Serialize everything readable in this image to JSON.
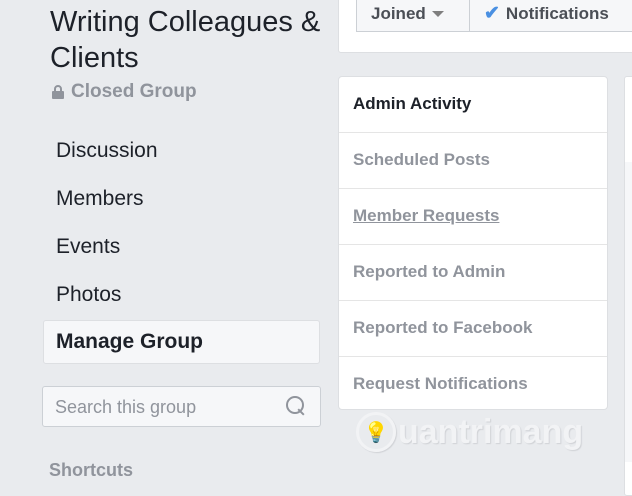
{
  "group": {
    "title": "Writing Colleagues & Clients",
    "privacy": "Closed Group"
  },
  "nav": [
    {
      "label": "Discussion"
    },
    {
      "label": "Members"
    },
    {
      "label": "Events"
    },
    {
      "label": "Photos"
    },
    {
      "label": "Manage Group",
      "active": true
    }
  ],
  "search": {
    "placeholder": "Search this group"
  },
  "shortcuts_label": "Shortcuts",
  "header_buttons": {
    "joined": "Joined",
    "notifications": "Notifications"
  },
  "manage_menu": [
    {
      "label": "Admin Activity"
    },
    {
      "label": "Scheduled Posts"
    },
    {
      "label": "Member Requests"
    },
    {
      "label": "Reported to Admin"
    },
    {
      "label": "Reported to Facebook"
    },
    {
      "label": "Request Notifications"
    }
  ],
  "watermark": "Quantrimang",
  "colors": {
    "accent": "#4a90e2",
    "muted": "#90949c",
    "background": "#e9ebee"
  }
}
